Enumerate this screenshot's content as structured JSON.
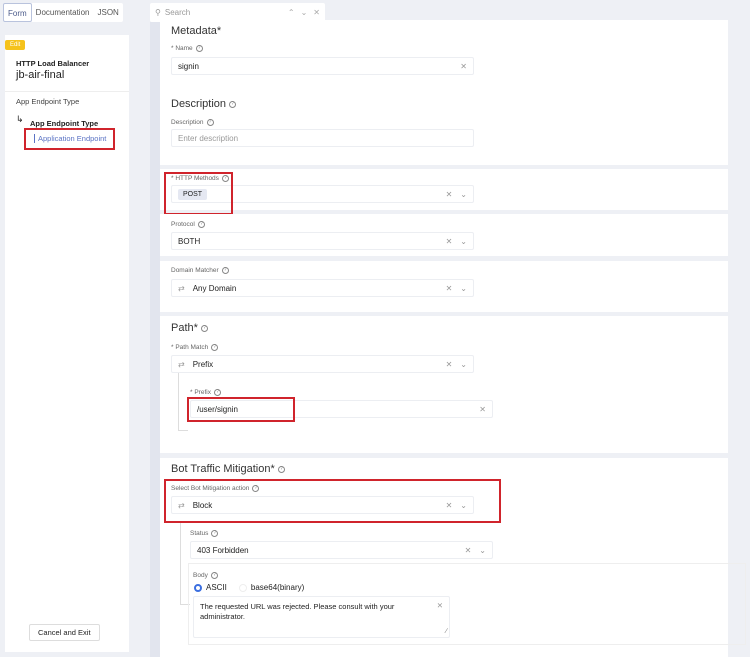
{
  "top_tabs": [
    "Form",
    "Documentation",
    "JSON"
  ],
  "search": {
    "placeholder": "Search"
  },
  "sidebar": {
    "badge": "Edit",
    "type": "HTTP Load Balancer",
    "name": "jb-air-final",
    "section": "App Endpoint Type",
    "sub": "App Endpoint Type",
    "item": "Application Endpoint",
    "cancel": "Cancel and Exit"
  },
  "metadata": {
    "title": "Metadata",
    "name_label": "* Name",
    "name_value": "signin"
  },
  "description": {
    "title": "Description",
    "label": "Description",
    "placeholder": "Enter description"
  },
  "http_methods": {
    "label": "* HTTP Methods",
    "value": "POST"
  },
  "protocol": {
    "label": "Protocol",
    "value": "BOTH"
  },
  "domain": {
    "label": "Domain Matcher",
    "value": "Any Domain"
  },
  "path": {
    "title": "Path",
    "match_label": "* Path Match",
    "match_value": "Prefix",
    "prefix_label": "* Prefix",
    "prefix_value": "/user/signin"
  },
  "bot": {
    "title": "Bot Traffic Mitigation",
    "action_label": "Select Bot Mitigation action",
    "action_value": "Block",
    "status_label": "Status",
    "status_value": "403 Forbidden",
    "body_label": "Body",
    "radio1": "ASCII",
    "radio2": "base64(binary)",
    "body_value": "The requested URL was rejected. Please consult with your administrator."
  }
}
